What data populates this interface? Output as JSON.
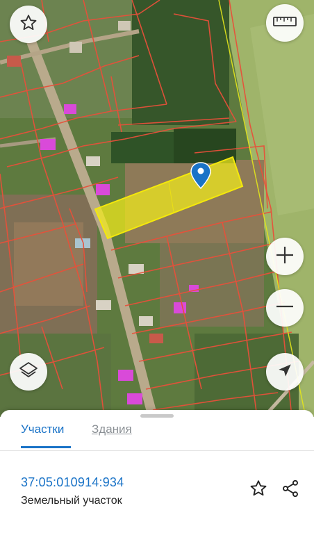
{
  "map": {
    "buttons": {
      "favorite": "star-icon",
      "ruler": "ruler-icon",
      "zoom_in": "plus-icon",
      "zoom_out": "minus-icon",
      "layers": "layers-icon",
      "locate": "location-arrow-icon"
    },
    "colors": {
      "parcel_border": "#e8503a",
      "selected_fill": "#f2ec1c",
      "marker": "#1a73c7",
      "building": "#d94ad9"
    }
  },
  "sheet": {
    "tabs": [
      {
        "label": "Участки",
        "active": true
      },
      {
        "label": "Здания",
        "active": false
      }
    ],
    "parcel": {
      "cadastral_number": "37:05:010914:934",
      "type": "Земельный участок"
    }
  },
  "colors": {
    "accent": "#1a73c7"
  }
}
